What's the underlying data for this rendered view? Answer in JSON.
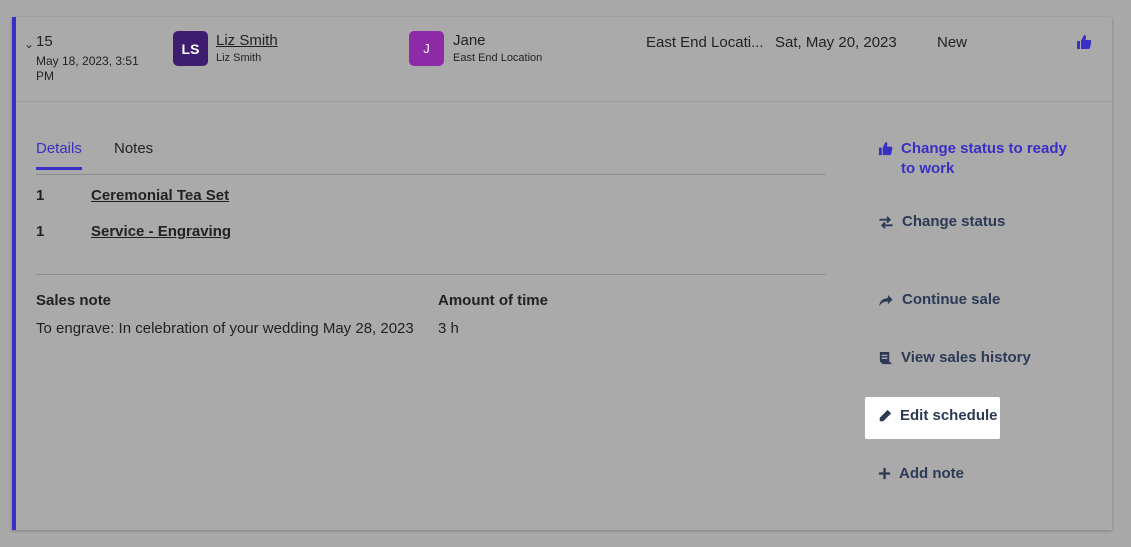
{
  "row": {
    "number": "15",
    "created": "May 18, 2023, 3:51 PM",
    "customer": {
      "initials": "LS",
      "name": "Liz Smith",
      "sub": "Liz Smith",
      "color": "#3e1d6e"
    },
    "assignee": {
      "initials": "J",
      "name": "Jane",
      "sub": "East End Location",
      "color": "#8e2aa8"
    },
    "location": "East End Locati...",
    "due_date": "Sat, May 20, 2023",
    "status": "New"
  },
  "tabs": [
    {
      "label": "Details"
    },
    {
      "label": "Notes"
    }
  ],
  "items": [
    {
      "qty": "1",
      "name": "Ceremonial Tea Set"
    },
    {
      "qty": "1",
      "name": "Service - Engraving"
    }
  ],
  "info": {
    "sales_note_label": "Sales note",
    "sales_note_value": "To engrave: In celebration of your wedding May 28, 2023",
    "time_label": "Amount of time",
    "time_value": "3 h"
  },
  "actions": {
    "ready": "Change status to ready to work",
    "change_status": "Change status",
    "continue_sale": "Continue sale",
    "history": "View sales history",
    "edit_schedule": "Edit schedule",
    "add_note": "Add note"
  },
  "colors": {
    "accent": "#3a2fc4",
    "action_text": "#2d3a55"
  }
}
